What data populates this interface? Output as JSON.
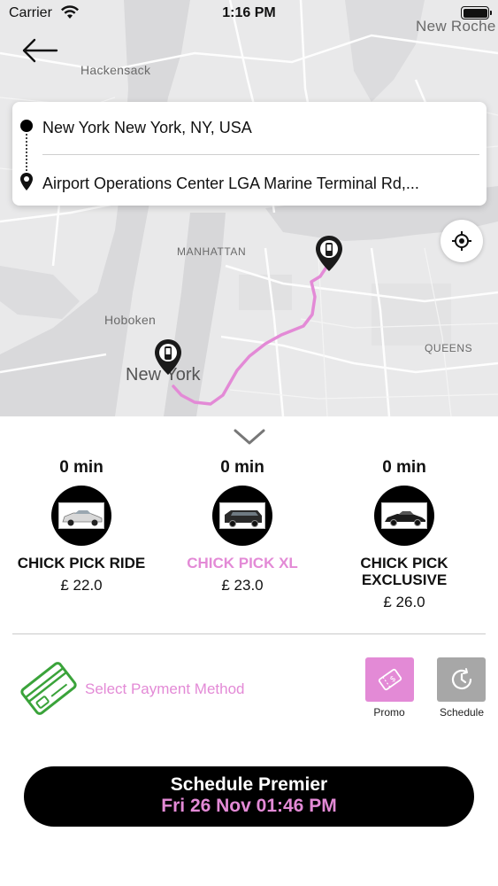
{
  "status_bar": {
    "carrier": "Carrier",
    "time": "1:16 PM"
  },
  "map": {
    "labels": {
      "hackensack": "Hackensack",
      "new_rochelle": "New Roche",
      "manhattan": "MANHATTAN",
      "hoboken": "Hoboken",
      "queens": "QUEENS",
      "new_york": "New York"
    },
    "route_color": "#e38ad6"
  },
  "address": {
    "pickup": "New York New York, NY, USA",
    "dropoff": "Airport Operations Center LGA Marine Terminal Rd,..."
  },
  "vehicles": [
    {
      "eta": "0 min",
      "name": "CHICK PICK RIDE",
      "price": "£ 22.0",
      "selected": false
    },
    {
      "eta": "0 min",
      "name": "CHICK PICK XL",
      "price": "£ 23.0",
      "selected": true
    },
    {
      "eta": "0 min",
      "name_line1": "CHICK PICK",
      "name_line2": "EXCLUSIVE",
      "price": "£ 26.0",
      "selected": false
    }
  ],
  "payment": {
    "label": "Select Payment Method"
  },
  "actions": {
    "promo": "Promo",
    "schedule": "Schedule"
  },
  "cta": {
    "title": "Schedule Premier",
    "datetime": "Fri 26 Nov 01:46 PM"
  },
  "colors": {
    "accent": "#e38ad6",
    "card_icon": "#3aa33a",
    "schedule_button": "#a7a7a7"
  }
}
